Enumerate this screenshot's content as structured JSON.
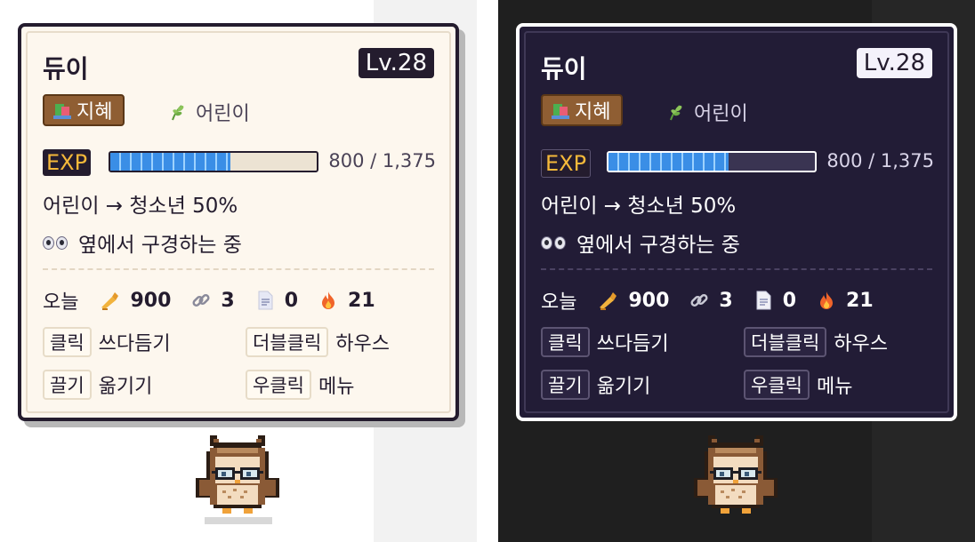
{
  "panels": [
    {
      "theme": "light"
    },
    {
      "theme": "dark"
    }
  ],
  "pet": {
    "name": "듀이",
    "level": "Lv.28",
    "trait": "지혜",
    "stage": "어린이",
    "exp_tag": "EXP",
    "exp_progress": 0.58,
    "exp_text": "800 / 1,375",
    "growth_text": "어린이 → 청소년 50%",
    "status_text": "옆에서 구경하는 중",
    "today": {
      "label": "오늘",
      "typing": "900",
      "links": "3",
      "docs": "0",
      "streak": "21"
    },
    "hints": [
      {
        "key": "클릭",
        "action": "쓰다듬기"
      },
      {
        "key": "더블클릭",
        "action": "하우스"
      },
      {
        "key": "끌기",
        "action": "옮기기"
      },
      {
        "key": "우클릭",
        "action": "메뉴"
      }
    ]
  },
  "icons": {
    "trait_icon": "book-stack-icon",
    "stage_icon": "sprout-icon",
    "status_icon": "eyes-icon",
    "typing_icon": "writing-hand-icon",
    "links_icon": "link-icon",
    "docs_icon": "document-icon",
    "streak_icon": "fire-icon",
    "mascot": "owl-with-glasses"
  },
  "colors": {
    "exp_fill": "#3a8ee6",
    "trait_badge": "#8f5e33",
    "exp_tag_text": "#f5b93a"
  }
}
